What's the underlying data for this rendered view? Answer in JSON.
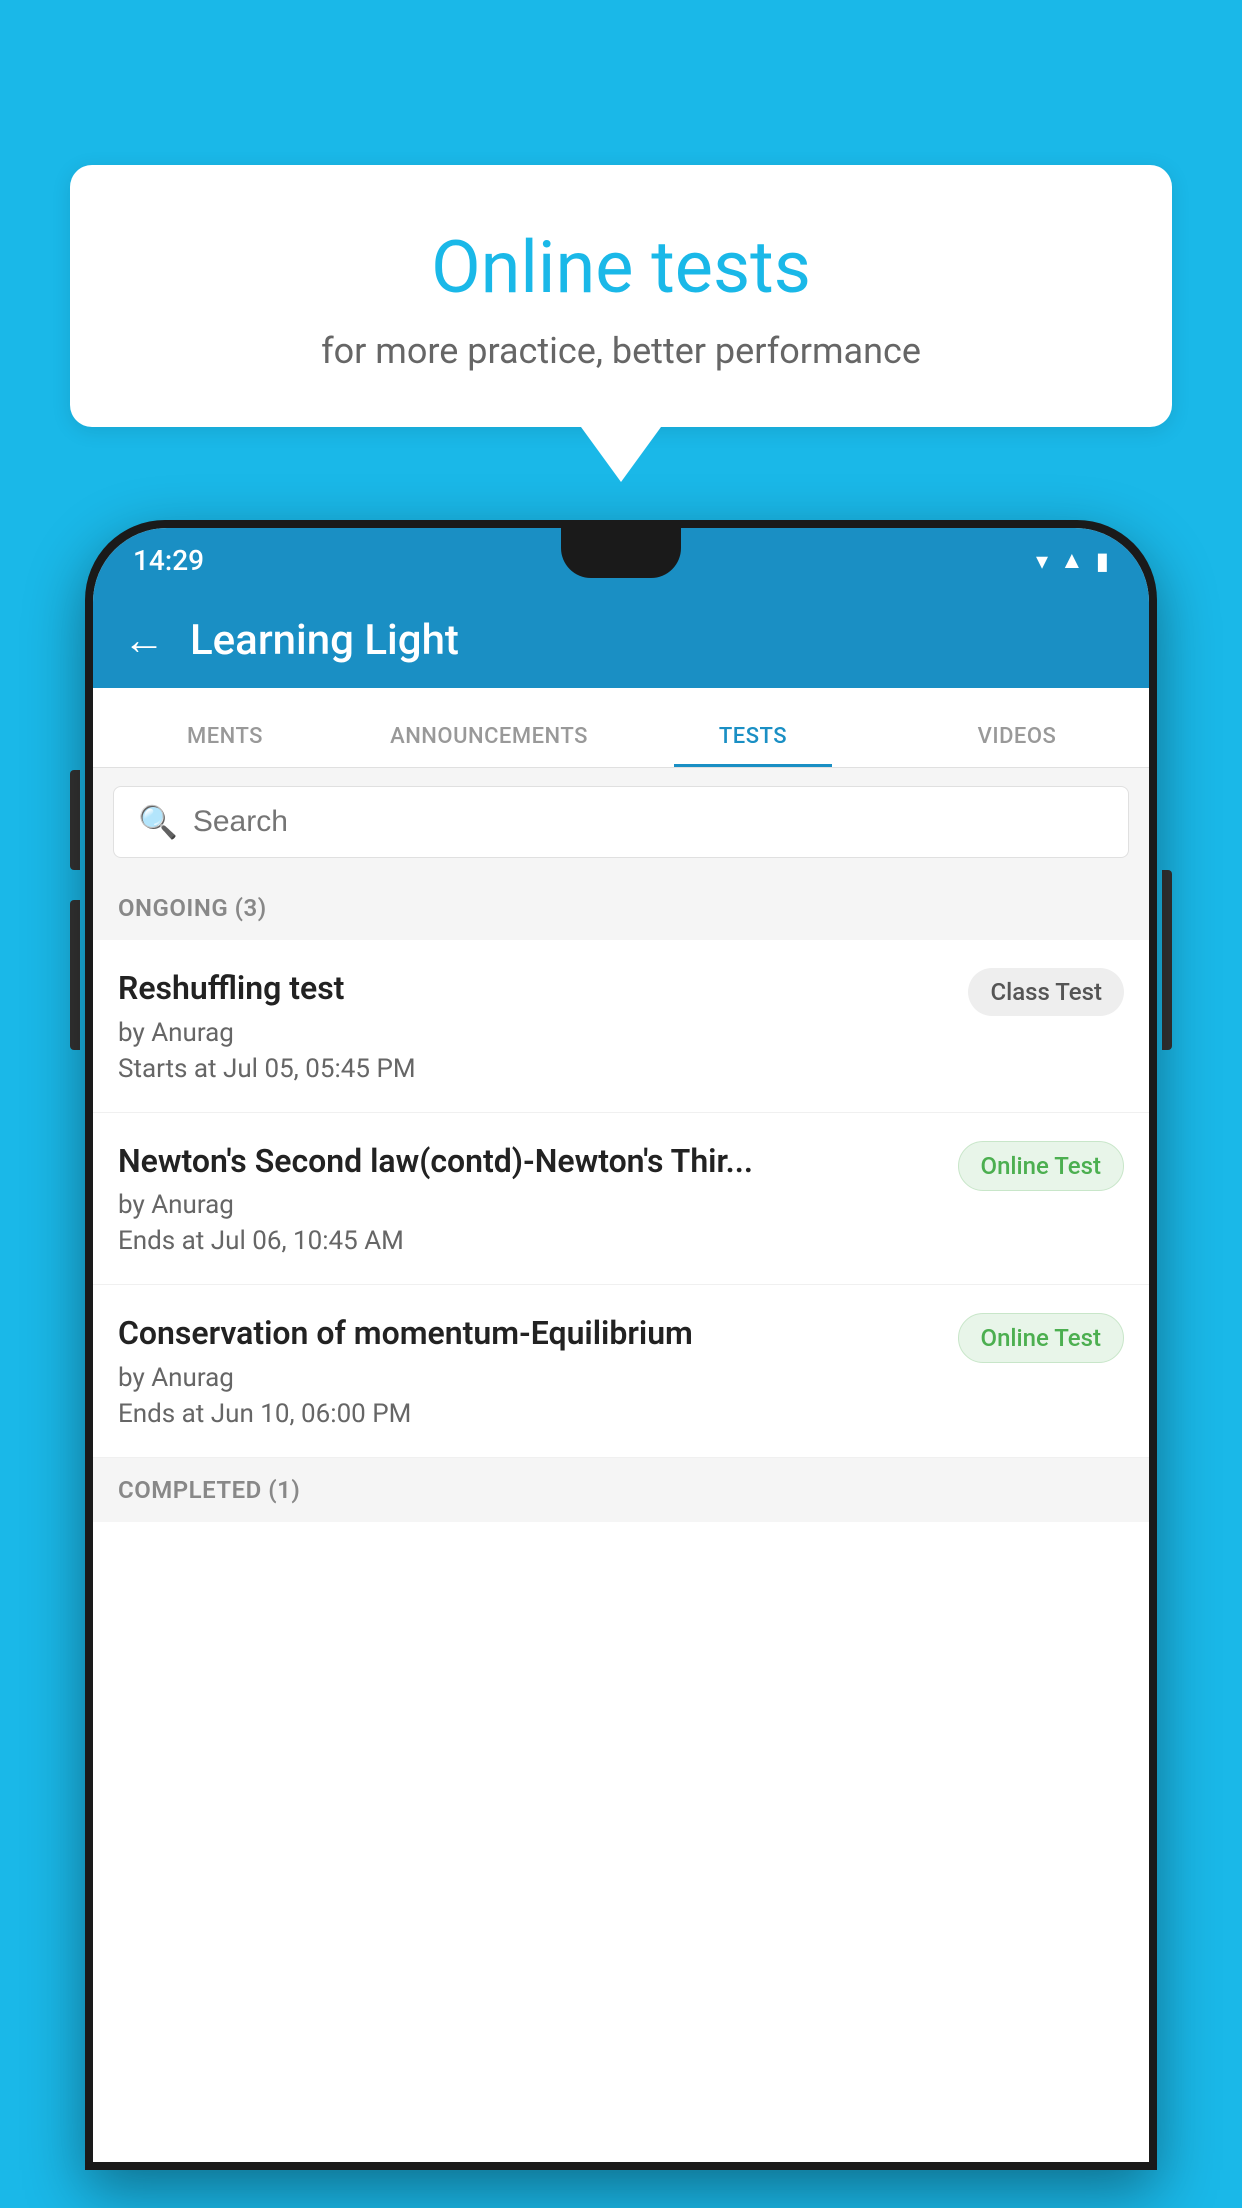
{
  "background": {
    "color": "#1ab8e8"
  },
  "speech_bubble": {
    "title": "Online tests",
    "subtitle": "for more practice, better performance"
  },
  "phone": {
    "status_bar": {
      "time": "14:29",
      "icons": [
        "wifi",
        "signal",
        "battery"
      ]
    },
    "header": {
      "back_label": "←",
      "title": "Learning Light"
    },
    "tabs": [
      {
        "label": "MENTS",
        "active": false
      },
      {
        "label": "ANNOUNCEMENTS",
        "active": false
      },
      {
        "label": "TESTS",
        "active": true
      },
      {
        "label": "VIDEOS",
        "active": false
      }
    ],
    "search": {
      "placeholder": "Search"
    },
    "ongoing_section": {
      "label": "ONGOING (3)"
    },
    "tests": [
      {
        "title": "Reshuffling test",
        "author": "by Anurag",
        "date": "Starts at  Jul 05, 05:45 PM",
        "badge": "Class Test",
        "badge_type": "class"
      },
      {
        "title": "Newton's Second law(contd)-Newton's Thir...",
        "author": "by Anurag",
        "date": "Ends at  Jul 06, 10:45 AM",
        "badge": "Online Test",
        "badge_type": "online"
      },
      {
        "title": "Conservation of momentum-Equilibrium",
        "author": "by Anurag",
        "date": "Ends at  Jun 10, 06:00 PM",
        "badge": "Online Test",
        "badge_type": "online"
      }
    ],
    "completed_section": {
      "label": "COMPLETED (1)"
    }
  }
}
